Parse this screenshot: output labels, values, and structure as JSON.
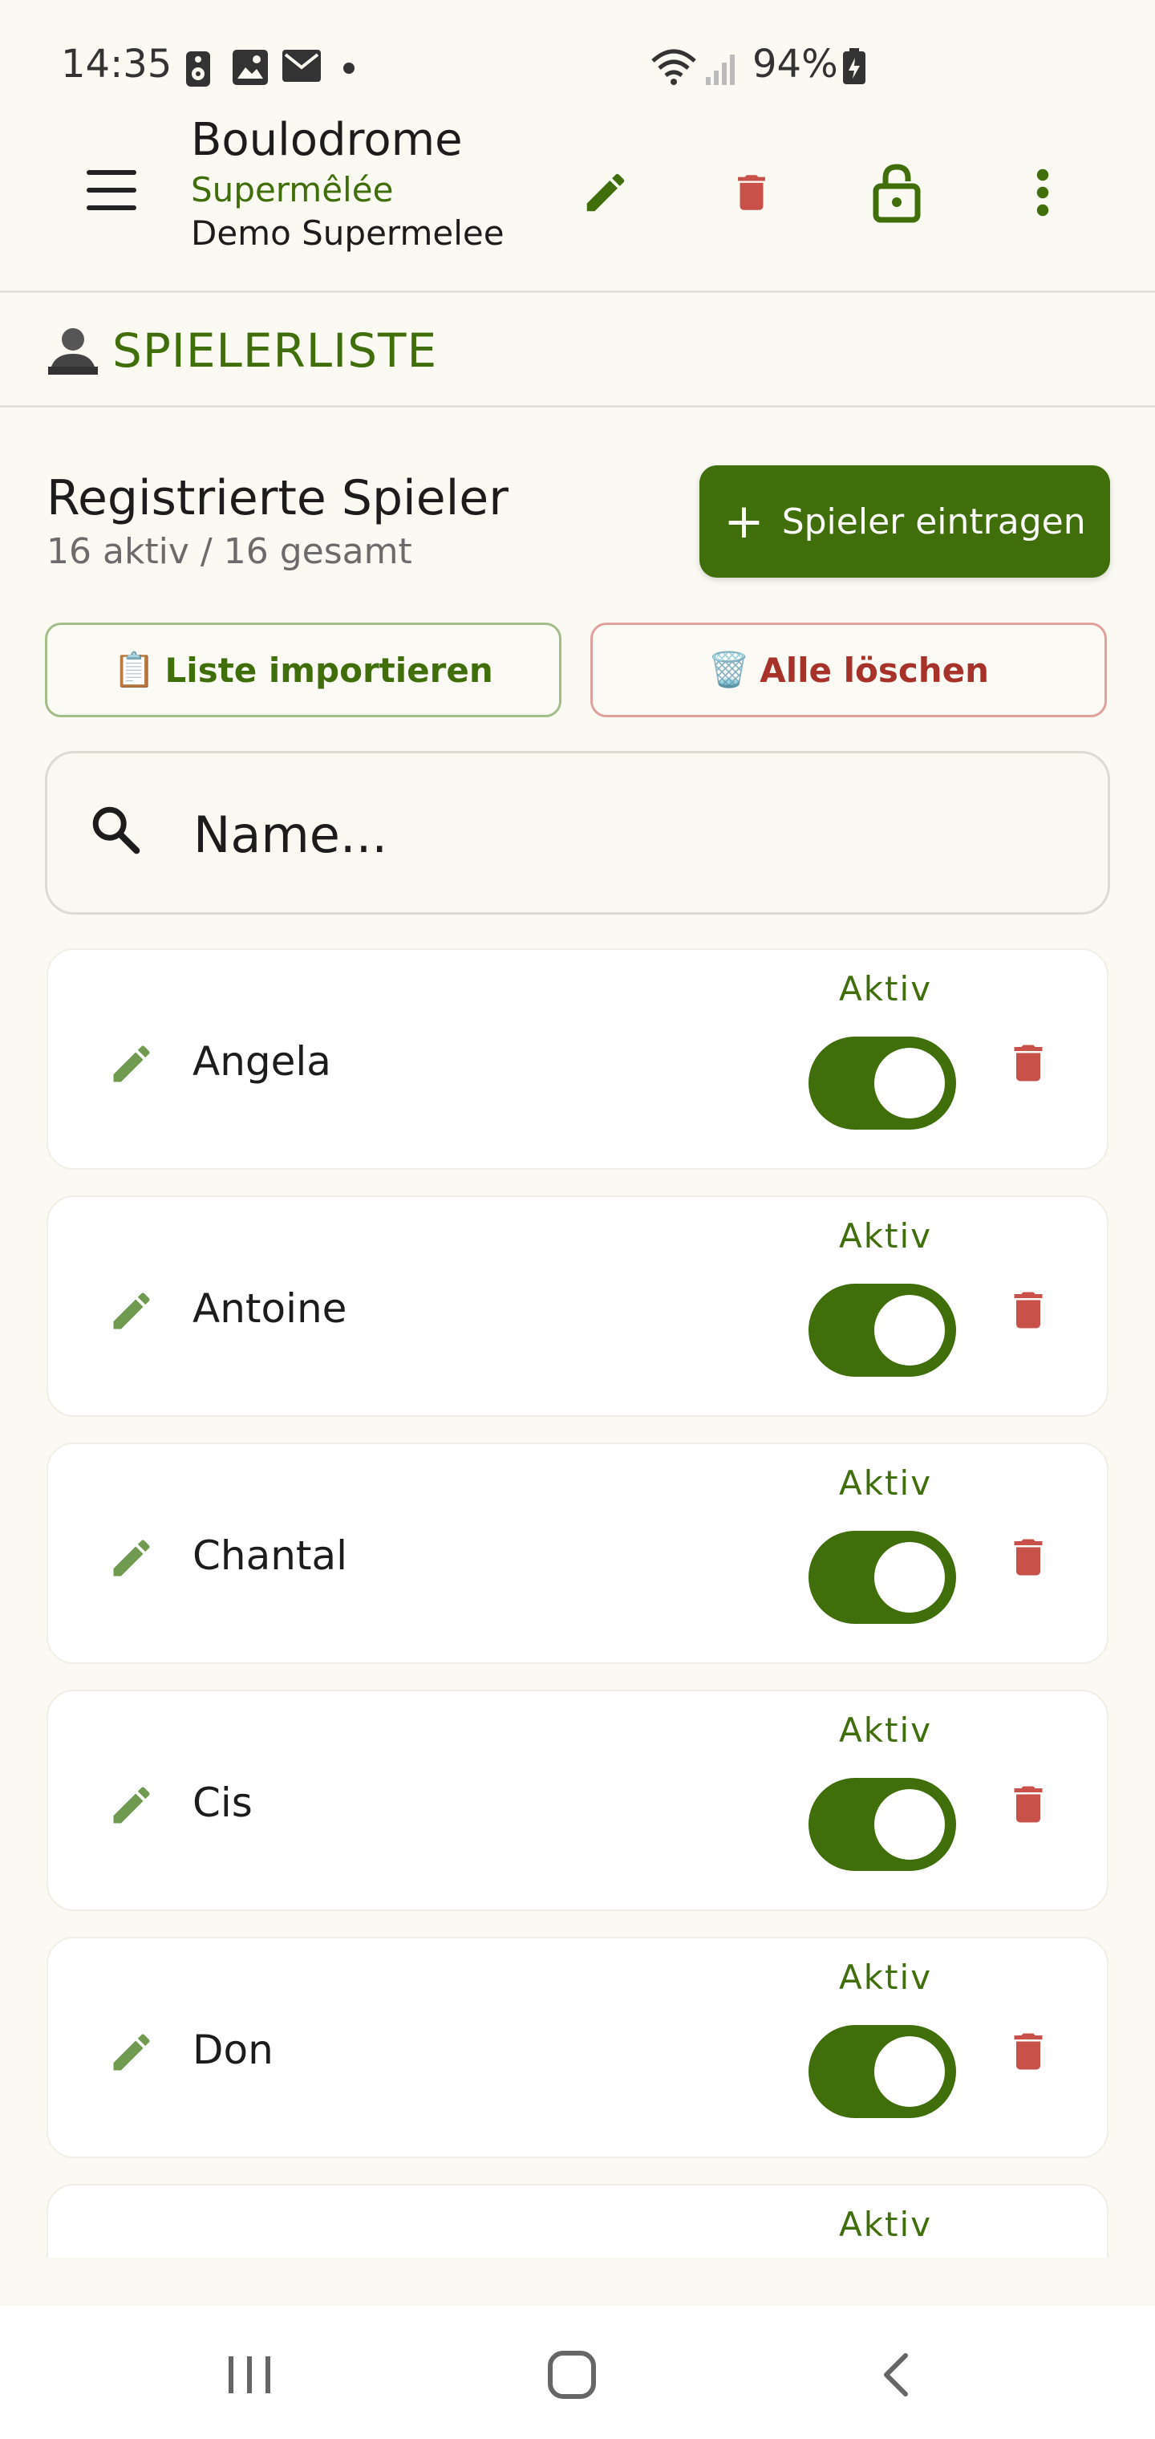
{
  "status_bar": {
    "time": "14:35",
    "battery": "94%",
    "icons": [
      "speaker-icon",
      "image-icon",
      "mail-icon",
      "wifi-icon",
      "signal-icon",
      "battery-icon"
    ]
  },
  "app_bar": {
    "title": "Boulodrome",
    "subtitle": "Supermêlée",
    "subtitle2": "Demo Supermelee",
    "actions": [
      "edit-icon",
      "delete-icon",
      "unlock-icon",
      "more-vert-icon"
    ]
  },
  "section": {
    "title": "SPIELERLISTE",
    "icon": "person-icon"
  },
  "registered": {
    "title": "Registrierte Spieler",
    "count": "16 aktiv / 16 gesamt",
    "add_plus": "+",
    "add_label": "Spieler eintragen",
    "import_emoji": "📋",
    "import_label": "Liste importieren",
    "delete_emoji": "🗑️",
    "delete_label": "Alle löschen"
  },
  "search": {
    "placeholder": "Name..."
  },
  "players": [
    {
      "name": "Angela",
      "status": "Aktiv",
      "active": true
    },
    {
      "name": "Antoine",
      "status": "Aktiv",
      "active": true
    },
    {
      "name": "Chantal",
      "status": "Aktiv",
      "active": true
    },
    {
      "name": "Cis",
      "status": "Aktiv",
      "active": true
    },
    {
      "name": "Don",
      "status": "Aktiv",
      "active": true
    },
    {
      "name": "",
      "status": "Aktiv",
      "active": true
    }
  ],
  "colors": {
    "primary": "#3f6e0b",
    "danger": "#c8514a",
    "background": "#faf9f2"
  }
}
